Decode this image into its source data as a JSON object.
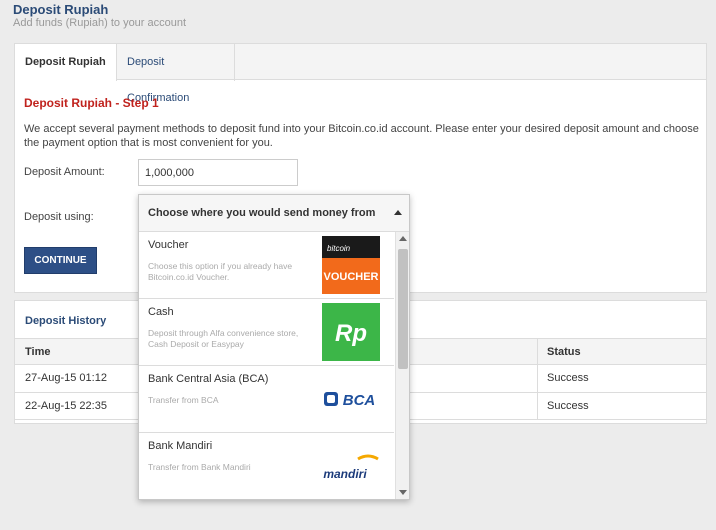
{
  "header": {
    "title": "Deposit Rupiah",
    "subtitle": "Add funds (Rupiah) to your account"
  },
  "tabs": [
    {
      "label": "Deposit Rupiah",
      "active": true
    },
    {
      "label": "Deposit Confirmation",
      "active": false
    }
  ],
  "form": {
    "step_title": "Deposit Rupiah - Step 1",
    "intro": "We accept several payment methods to deposit fund into your Bitcoin.co.id account. Please enter your desired deposit amount and choose the payment option that is most convenient for you.",
    "amount_label": "Deposit Amount:",
    "amount_value": "1,000,000",
    "using_label": "Deposit using:",
    "continue_label": "CONTINUE"
  },
  "dropdown": {
    "placeholder": "Choose where you would send money from",
    "options": [
      {
        "name": "Voucher",
        "desc": "Choose this option if you already have Bitcoin.co.id Voucher.",
        "logo_icon": "bitcoin-voucher-logo-icon",
        "logo_text": "VOUCHER",
        "logo_small": "bitcoin"
      },
      {
        "name": "Cash",
        "desc": "Deposit through Alfa convenience store, Cash Deposit or Easypay",
        "logo_icon": "rp-logo-icon",
        "logo_text": "Rp"
      },
      {
        "name": "Bank Central Asia (BCA)",
        "desc": "Transfer from BCA",
        "logo_icon": "bca-logo-icon",
        "logo_text": "BCA"
      },
      {
        "name": "Bank Mandiri",
        "desc": "Transfer from Bank Mandiri",
        "logo_icon": "mandiri-logo-icon",
        "logo_text": "mandiri"
      }
    ]
  },
  "history": {
    "title": "Deposit History",
    "columns": [
      "Time",
      "Status"
    ],
    "rows": [
      {
        "time": "27-Aug-15 01:12",
        "status": "Success"
      },
      {
        "time": "22-Aug-15 22:35",
        "status": "Success"
      }
    ]
  },
  "colors": {
    "accent": "#2b4b77",
    "step_red": "#c0221d",
    "button": "#2d4f86",
    "rp_green": "#3cb648",
    "voucher_orange": "#f26a1b",
    "bca_blue": "#1e4f9c",
    "mandiri_blue": "#1b3a7a",
    "mandiri_yellow": "#f5a800"
  }
}
